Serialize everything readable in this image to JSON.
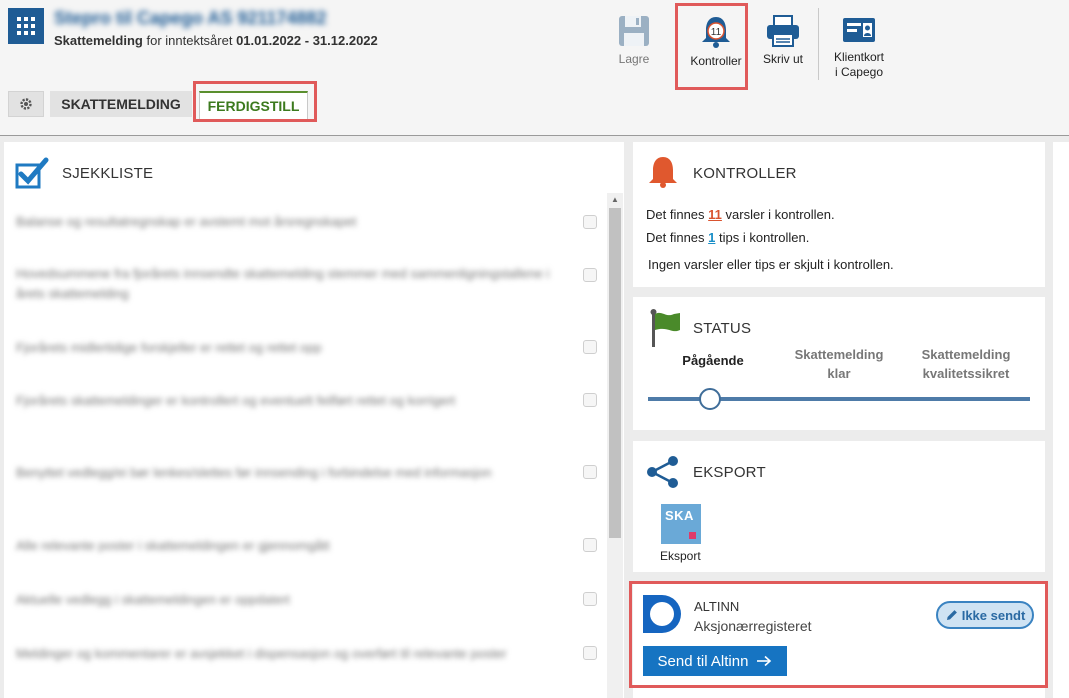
{
  "header": {
    "company_name": "Stepro til Capego AS 921174882",
    "subtitle_doc": "Skattemelding",
    "subtitle_for": " for inntektsåret ",
    "subtitle_period": "01.01.2022 - 31.12.2022"
  },
  "toolbar": {
    "save_label": "Lagre",
    "controls_label": "Kontroller",
    "controls_badge": "11",
    "print_label": "Skriv ut",
    "clientcard_line1": "Klientkort",
    "clientcard_line2": "i Capego"
  },
  "tabs": {
    "tab1": "SKATTEMELDING",
    "tab2": "FERDIGSTILL"
  },
  "checklist": {
    "title": "SJEKKLISTE",
    "items": [
      "Balanse og resultatregnskap er avstemt mot årsregnskapet",
      "Hovedsummene fra fjorårets innsendte skattemelding stemmer med sammenligningstallene i årets skattemelding",
      "Fjorårets midlertidige forskjeller er rettet og rettet opp",
      "Fjorårets skattemeldinger er kontrollert og eventuelt feilført rettet og korrigert",
      "Benyttet vedlegg/ei bør lenkes/slettes før innsending i forbindelse med informasjon",
      "Alle relevante poster i skattemeldingen er gjennomgått",
      "Aktuelle vedlegg i skattemeldingen er oppdatert",
      "Meldinger og kommentarer er avsjekket i dispensasjon og overført til relevante poster"
    ]
  },
  "kontroller": {
    "title": "KONTROLLER",
    "line1_pre": "Det finnes ",
    "line1_count": "11",
    "line1_post": " varsler i kontrollen.",
    "line2_pre": "Det finnes ",
    "line2_count": "1",
    "line2_post": " tips i kontrollen.",
    "line3": "Ingen varsler eller tips er skjult i kontrollen."
  },
  "status": {
    "title": "STATUS",
    "step1": "Pågående",
    "step2_line1": "Skattemelding",
    "step2_line2": "klar",
    "step3_line1": "Skattemelding",
    "step3_line2": "kvalitetssikret",
    "current_step": "Pågående"
  },
  "eksport": {
    "title": "EKSPORT",
    "tile_text": "SKA",
    "tile_label": "Eksport"
  },
  "altinn": {
    "title": "ALTINN",
    "subtitle": "Aksjonærregisteret",
    "status_label": "Ikke sendt",
    "send_label": "Send til Altinn"
  },
  "colors": {
    "brand_blue": "#1f5c95",
    "accent_blue": "#1674c2",
    "green": "#3c7a1e",
    "warning_red": "#d9532f",
    "highlight_red": "#e05a5a"
  }
}
